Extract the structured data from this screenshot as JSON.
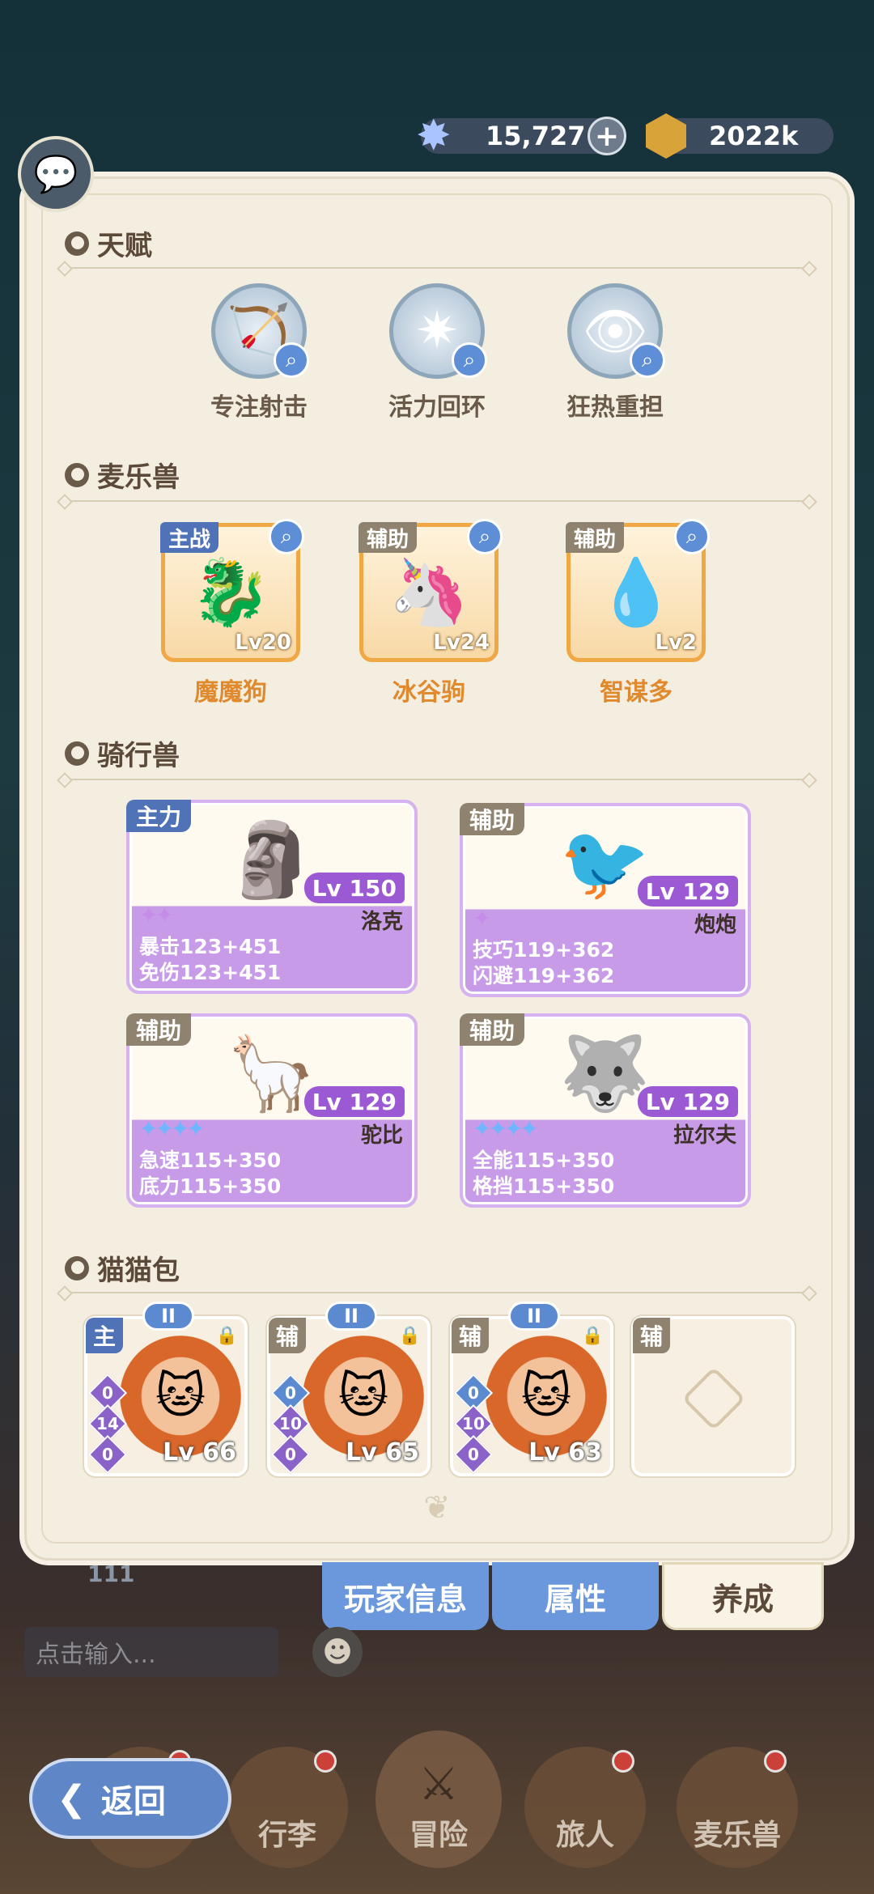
{
  "currency": {
    "stars": "15,727",
    "plus": "+",
    "coins": "2022k"
  },
  "talent": {
    "title": "天赋",
    "items": [
      {
        "label": "专注射击",
        "icon": "bow-icon"
      },
      {
        "label": "活力回环",
        "icon": "compass-star-icon"
      },
      {
        "label": "狂热重担",
        "icon": "eye-shield-icon"
      }
    ]
  },
  "pets": {
    "title": "麦乐兽",
    "items": [
      {
        "role": "主战",
        "name": "魔魔狗",
        "level": "Lv20"
      },
      {
        "role": "辅助",
        "name": "冰谷驹",
        "level": "Lv24"
      },
      {
        "role": "辅助",
        "name": "智谋多",
        "level": "Lv2"
      }
    ]
  },
  "mounts": {
    "title": "骑行兽",
    "items": [
      {
        "role": "主力",
        "level": "Lv 150",
        "name": "洛克",
        "stat1": "暴击123+451",
        "stat2": "免伤123+451",
        "stars": "✦✦"
      },
      {
        "role": "辅助",
        "level": "Lv 129",
        "name": "炮炮",
        "stat1": "技巧119+362",
        "stat2": "闪避119+362",
        "stars": "✦"
      },
      {
        "role": "辅助",
        "level": "Lv 129",
        "name": "驼比",
        "stat1": "急速115+350",
        "stat2": "底力115+350",
        "stars": "✦✦✦✦"
      },
      {
        "role": "辅助",
        "level": "Lv 129",
        "name": "拉尔夫",
        "stat1": "全能115+350",
        "stat2": "格挡115+350",
        "stars": "✦✦✦✦"
      }
    ]
  },
  "cats": {
    "title": "猫猫包",
    "items": [
      {
        "role": "主",
        "tier": "II",
        "level": "Lv 66",
        "b1": "0",
        "b2": "14",
        "b3": "0"
      },
      {
        "role": "辅",
        "tier": "II",
        "level": "Lv 65",
        "b1": "0",
        "b2": "10",
        "b3": "0"
      },
      {
        "role": "辅",
        "tier": "II",
        "level": "Lv 63",
        "b1": "0",
        "b2": "10",
        "b3": "0"
      },
      {
        "role": "辅"
      }
    ]
  },
  "background": {
    "count": "111",
    "input_placeholder": "点击输入..."
  },
  "tabs": {
    "info": "玩家信息",
    "attr": "属性",
    "growth": "养成"
  },
  "nav": {
    "back": "返回",
    "bag": "行李",
    "adventure": "冒险",
    "traveler": "旅人",
    "pets": "麦乐兽"
  },
  "colors": {
    "main_role": "#4f73b6",
    "support_role": "#8f8370",
    "mount_purple": "#c79be8",
    "pet_name": "#e08a2d"
  }
}
